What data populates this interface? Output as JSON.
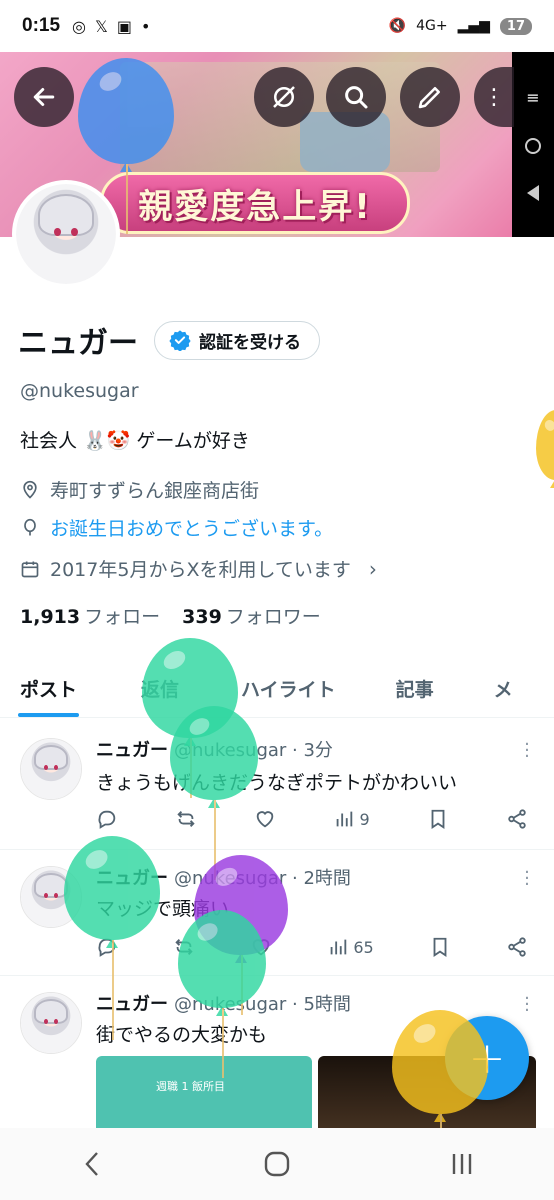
{
  "status_bar": {
    "time": "0:15",
    "network": "4G+",
    "battery": "17"
  },
  "banner": {
    "title": "親愛度急上昇!"
  },
  "profile": {
    "name": "ニュガー",
    "verify_label": "認証を受ける",
    "handle": "@nukesugar",
    "bio": "社会人 🐰🤡 ゲームが好き",
    "location": "寿町すずらん銀座商店街",
    "birthday": "お誕生日おめでとうございます。",
    "joined": "2017年5月からXを利用しています",
    "following_count": "1,913",
    "following_label": "フォロー",
    "followers_count": "339",
    "followers_label": "フォロワー"
  },
  "tabs": [
    "ポスト",
    "返信",
    "ハイライト",
    "記事",
    "メ"
  ],
  "posts": [
    {
      "name": "ニュガー",
      "meta": "@nukesugar · 3分",
      "text": "きょうもげんきだうなぎポテトがかわいい",
      "views": "9"
    },
    {
      "name": "ニュガー",
      "meta": "@nukesugar · 2時間",
      "text": "マッジで頭痛い",
      "views": "65"
    },
    {
      "name": "ニュガー",
      "meta": "@nukesugar · 5時間",
      "text": "街でやるの大変かも",
      "media_text": "週職 1 飯所目"
    }
  ],
  "fab": {
    "label": "+"
  },
  "colors": {
    "accent": "#1d9bf0",
    "text_primary": "#0f1419",
    "text_secondary": "#536471"
  }
}
